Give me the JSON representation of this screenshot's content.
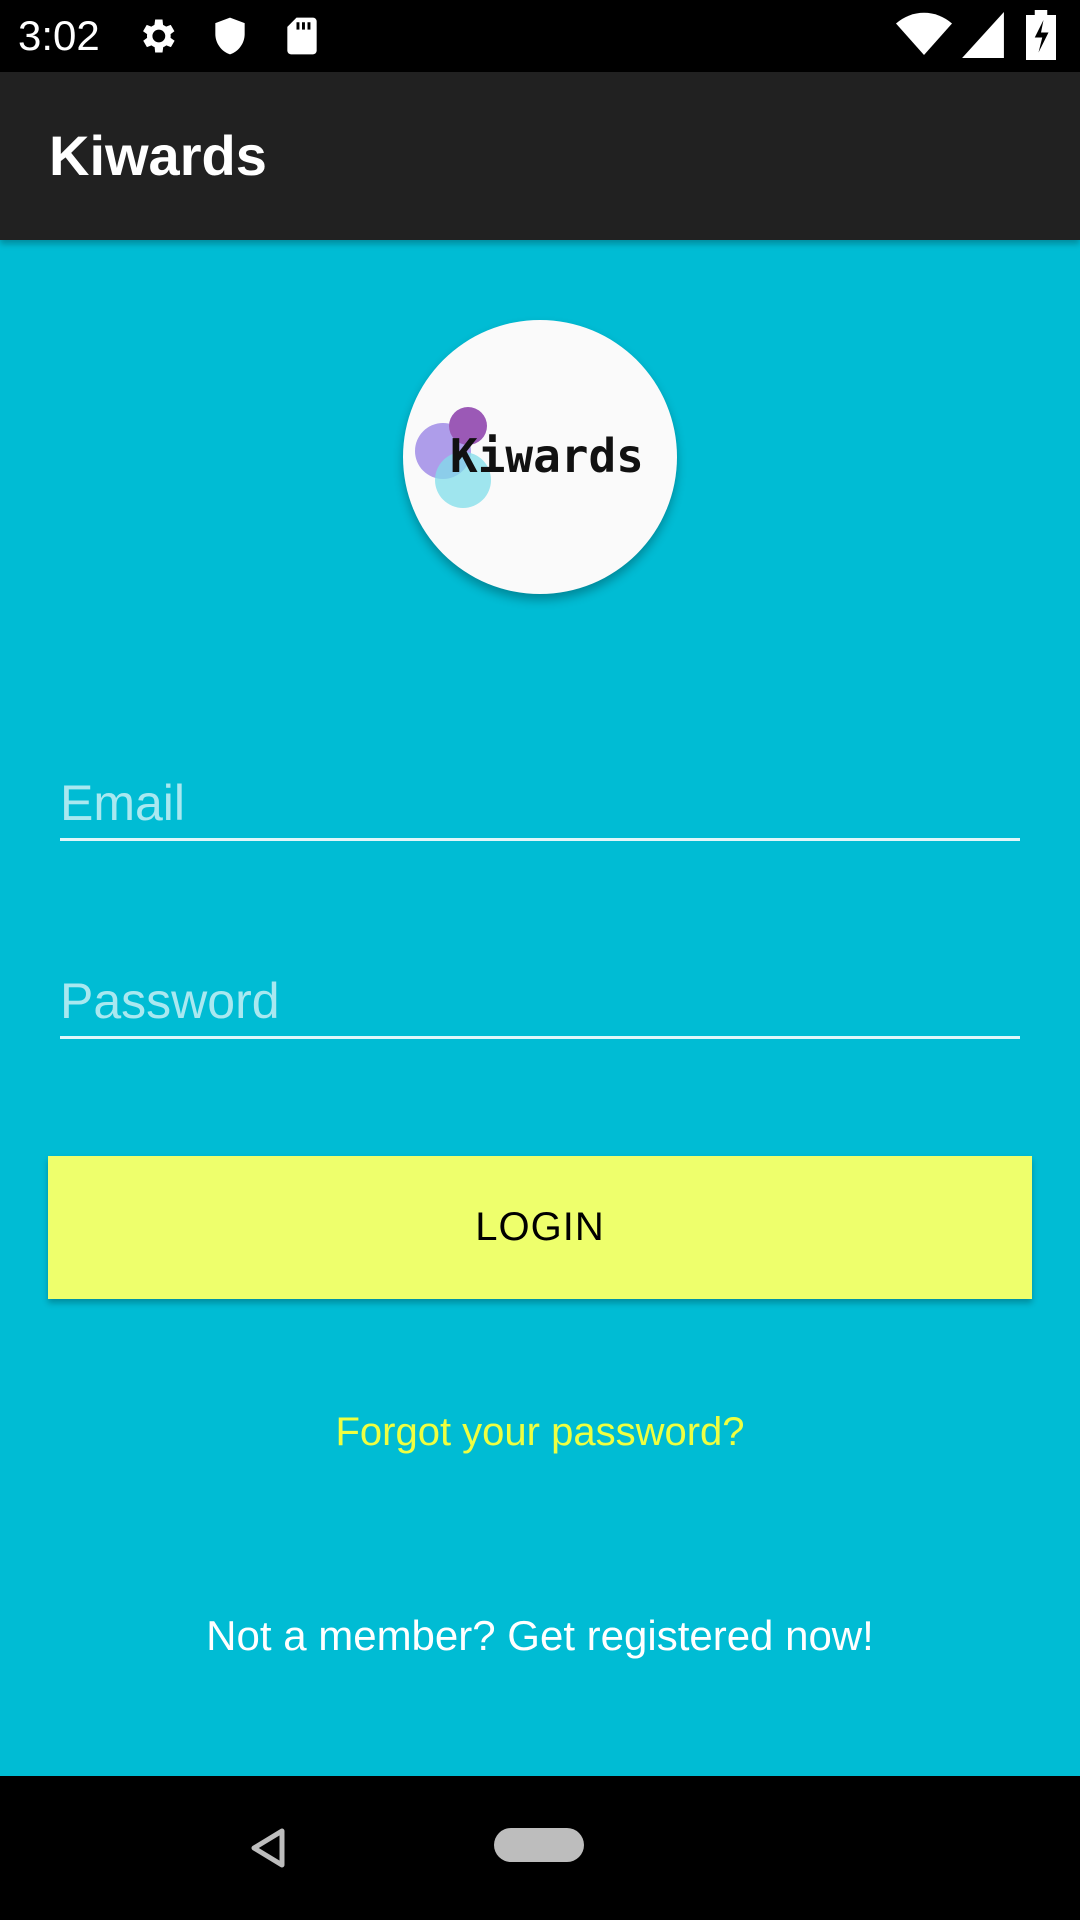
{
  "status_bar": {
    "time": "3:02",
    "icons": [
      "gear-icon",
      "shield-icon",
      "sd-card-icon",
      "wifi-icon",
      "cell-signal-icon",
      "battery-charging-icon"
    ]
  },
  "app_bar": {
    "title": "Kiwards"
  },
  "logo": {
    "text": "Kiwards"
  },
  "form": {
    "email_placeholder": "Email",
    "email_value": "",
    "password_placeholder": "Password",
    "password_value": ""
  },
  "actions": {
    "login_label": "LOGIN",
    "forgot_password": "Forgot your password?",
    "register": "Not a member? Get registered now!"
  },
  "nav_bar": {
    "icons": [
      "back-icon",
      "home-pill-icon"
    ]
  },
  "colors": {
    "background": "#00bcd4",
    "app_bar": "#212121",
    "login_button": "#eeff6c",
    "forgot_link": "#eeff41"
  }
}
